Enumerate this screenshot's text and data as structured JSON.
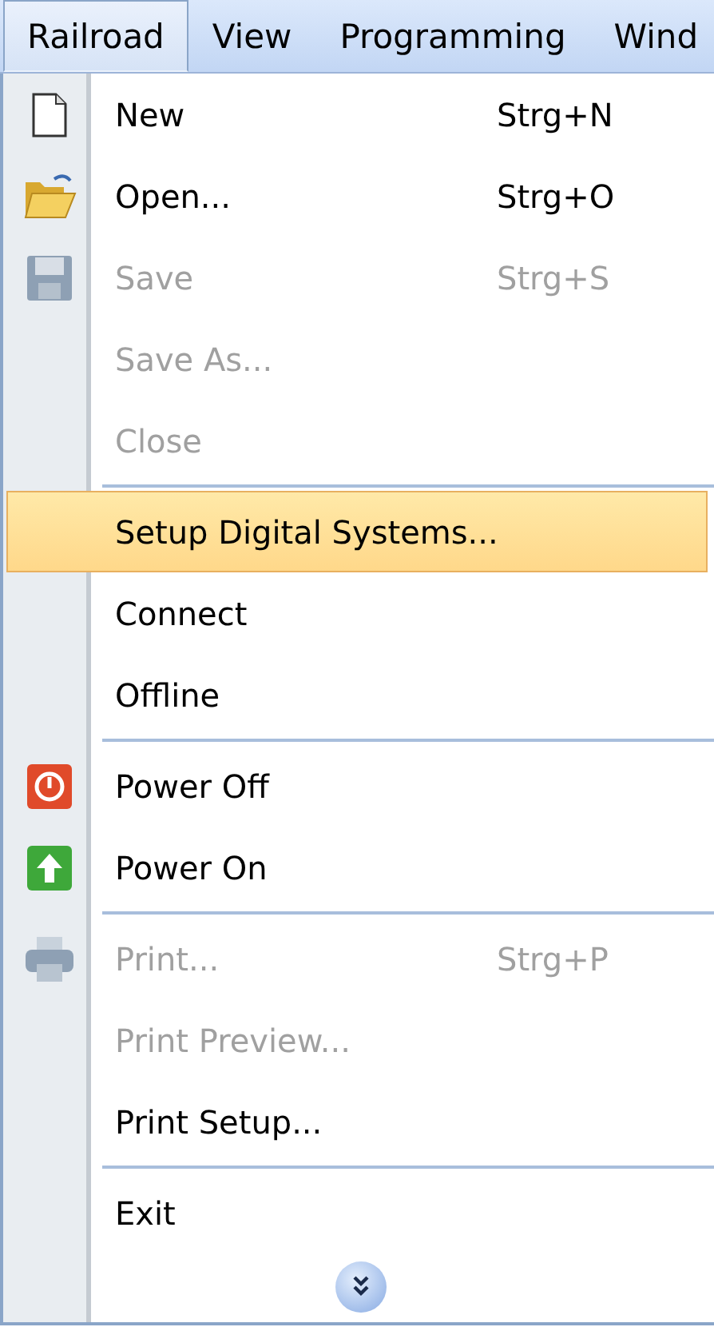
{
  "menubar": [
    {
      "label": "Railroad",
      "selected": true
    },
    {
      "label": "View",
      "selected": false
    },
    {
      "label": "Programming",
      "selected": false
    },
    {
      "label": "Wind",
      "selected": false
    }
  ],
  "menu": {
    "groups": [
      [
        {
          "label": "New",
          "shortcut": "Strg+N",
          "disabled": false,
          "selected": false
        },
        {
          "label": "Open...",
          "shortcut": "Strg+O",
          "disabled": false,
          "selected": false
        },
        {
          "label": "Save",
          "shortcut": "Strg+S",
          "disabled": true,
          "selected": false
        },
        {
          "label": "Save As...",
          "disabled": true,
          "selected": false
        },
        {
          "label": "Close",
          "disabled": true,
          "selected": false
        }
      ],
      [
        {
          "label": "Setup Digital Systems...",
          "disabled": false,
          "selected": true
        },
        {
          "label": "Connect",
          "disabled": false,
          "selected": false
        },
        {
          "label": "Offline",
          "disabled": false,
          "selected": false
        }
      ],
      [
        {
          "label": "Power Off",
          "disabled": false,
          "selected": false
        },
        {
          "label": "Power On",
          "disabled": false,
          "selected": false
        }
      ],
      [
        {
          "label": "Print...",
          "shortcut": "Strg+P",
          "disabled": true,
          "selected": false
        },
        {
          "label": "Print Preview...",
          "disabled": true,
          "selected": false
        },
        {
          "label": "Print Setup...",
          "disabled": false,
          "selected": false
        }
      ],
      [
        {
          "label": "Exit",
          "disabled": false,
          "selected": false
        }
      ]
    ],
    "more": true
  }
}
